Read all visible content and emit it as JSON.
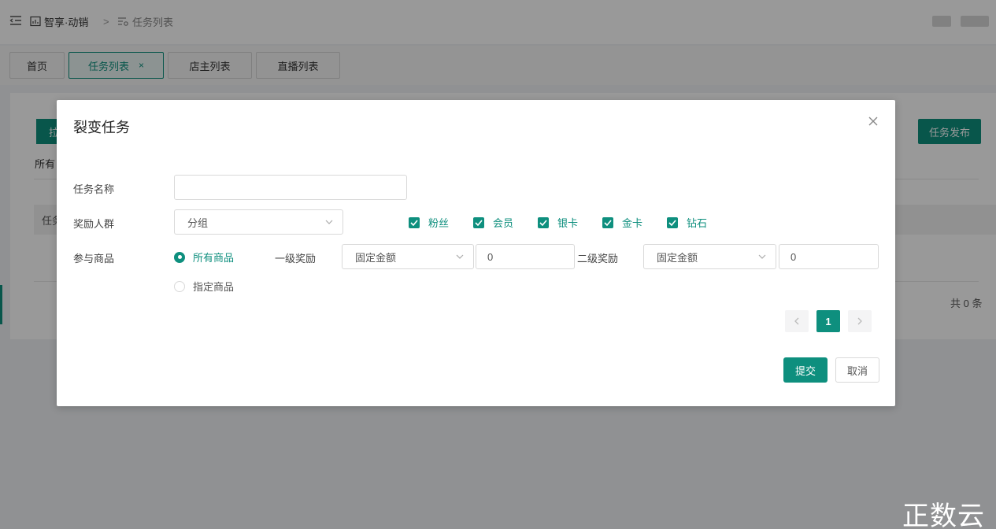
{
  "header": {
    "breadcrumb_home": "智享·动销",
    "breadcrumb_sep": ">",
    "breadcrumb_current": "任务列表"
  },
  "tabs": [
    {
      "label": "首页"
    },
    {
      "label": "任务列表",
      "close": "×"
    },
    {
      "label": "店主列表"
    },
    {
      "label": "直播列表"
    }
  ],
  "background": {
    "left_button_label": "拉",
    "publish_button_label": "任务发布",
    "filter_tab_label": "所有",
    "table_header_label": "任务",
    "total_label": "共 0 条"
  },
  "modal": {
    "title": "裂变任务",
    "task_name_label": "任务名称",
    "task_name_value": "",
    "reward_group_label": "奖励人群",
    "group_select_value": "分组",
    "group_checkboxes": [
      {
        "label": "粉丝",
        "checked": true
      },
      {
        "label": "会员",
        "checked": true
      },
      {
        "label": "银卡",
        "checked": true
      },
      {
        "label": "金卡",
        "checked": true
      },
      {
        "label": "钻石",
        "checked": true
      }
    ],
    "goods_label": "参与商品",
    "radio_all": "所有商品",
    "radio_specific": "指定商品",
    "level1_label": "一级奖励",
    "level1_type": "固定金额",
    "level1_amount": "0",
    "level2_label": "二级奖励",
    "level2_type": "固定金额",
    "level2_amount": "0",
    "pagination_current": "1",
    "submit_label": "提交",
    "cancel_label": "取消"
  },
  "colors": {
    "accent": "#0e8f7e",
    "overlay": "rgba(0,0,0,0.4)"
  },
  "watermark": "正数云"
}
